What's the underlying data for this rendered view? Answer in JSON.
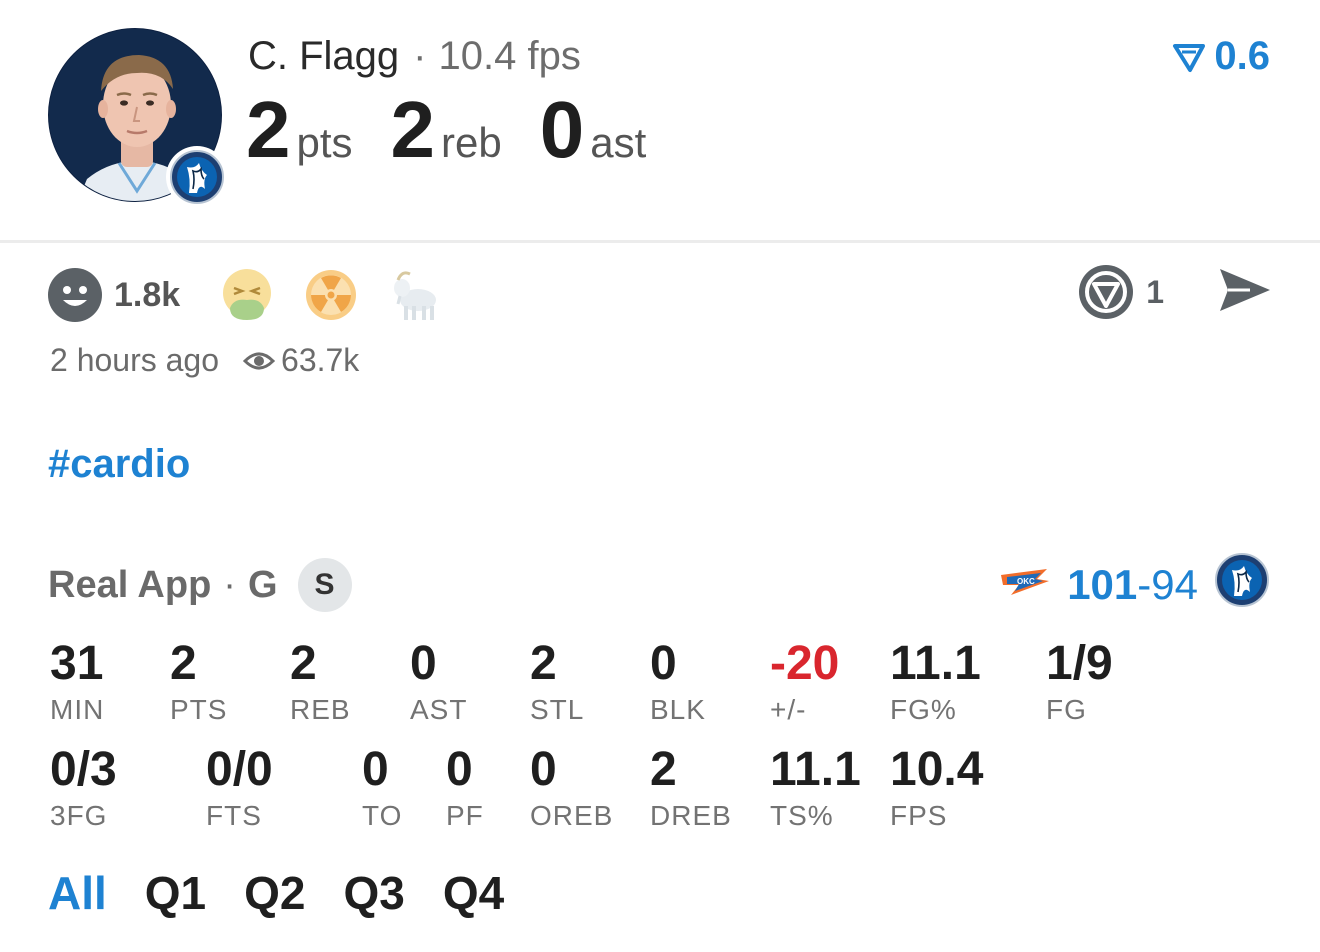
{
  "player": {
    "name": "C. Flagg",
    "separator": "·",
    "fps_text": "10.4 fps",
    "avatar": "player-headshot",
    "team_badge": "mavericks-logo"
  },
  "headline_stats": [
    {
      "value": "2",
      "unit": "pts"
    },
    {
      "value": "2",
      "unit": "reb"
    },
    {
      "value": "0",
      "unit": "ast"
    }
  ],
  "rating": {
    "icon": "filter-arrow-icon",
    "value": "0.6"
  },
  "reactions": {
    "primary": {
      "icon": "smiley-icon",
      "count": "1.8k"
    },
    "others": [
      "nauseated-face-emoji",
      "radioactive-emoji",
      "goat-emoji"
    ]
  },
  "comments": {
    "icon": "comment-logo-icon",
    "count": "1"
  },
  "share": {
    "icon": "send-icon"
  },
  "meta": {
    "time": "2 hours ago",
    "views_icon": "eye-icon",
    "views": "63.7k"
  },
  "hashtag": "#cardio",
  "game": {
    "source": "Real App",
    "separator": "·",
    "position": "G",
    "badge": "S",
    "away_logo": "thunder-logo",
    "home_logo": "mavericks-logo",
    "score_winner": "101",
    "score_dash": "-",
    "score_loser": "94"
  },
  "stats_row1": [
    {
      "value": "31",
      "label": "MIN"
    },
    {
      "value": "2",
      "label": "PTS"
    },
    {
      "value": "2",
      "label": "REB"
    },
    {
      "value": "0",
      "label": "AST"
    },
    {
      "value": "2",
      "label": "STL"
    },
    {
      "value": "0",
      "label": "BLK"
    },
    {
      "value": "-20",
      "label": "+/-"
    },
    {
      "value": "11.1",
      "label": "FG%"
    },
    {
      "value": "1/9",
      "label": "FG"
    }
  ],
  "stats_row2": [
    {
      "value": "0/3",
      "label": "3FG"
    },
    {
      "value": "0/0",
      "label": "FTS"
    },
    {
      "value": "0",
      "label": "TO"
    },
    {
      "value": "0",
      "label": "PF"
    },
    {
      "value": "0",
      "label": "OREB"
    },
    {
      "value": "2",
      "label": "DREB"
    },
    {
      "value": "11.1",
      "label": "TS%"
    },
    {
      "value": "10.4",
      "label": "FPS"
    }
  ],
  "colors": {
    "accent": "#1e82d2",
    "negative": "#d9262e",
    "muted": "#737373"
  },
  "tabs": [
    {
      "label": "All",
      "active": true
    },
    {
      "label": "Q1",
      "active": false
    },
    {
      "label": "Q2",
      "active": false
    },
    {
      "label": "Q3",
      "active": false
    },
    {
      "label": "Q4",
      "active": false
    }
  ]
}
